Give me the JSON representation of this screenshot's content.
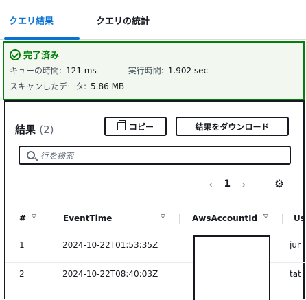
{
  "tabs": {
    "active_label": "クエリ結果",
    "inactive_label": "クエリの統計"
  },
  "status": {
    "title": "完了済み",
    "queue_time_label": "キューの時間:",
    "queue_time_value": "121 ms",
    "run_time_label": "実行時間:",
    "run_time_value": "1.902 sec",
    "data_scanned_label": "スキャンしたデータ:",
    "data_scanned_value": "5.86 MB",
    "accent_color": "#037f0c"
  },
  "results": {
    "title": "結果",
    "count": "(2)",
    "copy_label": "コピー",
    "download_label": "結果をダウンロード",
    "search_placeholder": "行を検索",
    "pagination": {
      "prev_icon": "chevron-left-icon",
      "current_page": "1",
      "next_icon": "chevron-right-icon"
    },
    "settings_icon": "gear-icon"
  },
  "table": {
    "columns": [
      {
        "label": "#",
        "sortable": true
      },
      {
        "label": "EventTime",
        "sortable": true
      },
      {
        "label": "AwsAccountId",
        "sortable": true
      },
      {
        "label": "Us",
        "sortable": false
      }
    ],
    "rows": [
      {
        "index": "1",
        "event_time": "2024-10-22T01:53:35Z",
        "account_id": "",
        "user_partial": "jur"
      },
      {
        "index": "2",
        "event_time": "2024-10-22T08:40:03Z",
        "account_id": "",
        "user_partial": "tat"
      }
    ]
  },
  "colors": {
    "tab_active": "#0972d3",
    "text_primary": "#16191f",
    "text_secondary": "#5f6b7a"
  }
}
